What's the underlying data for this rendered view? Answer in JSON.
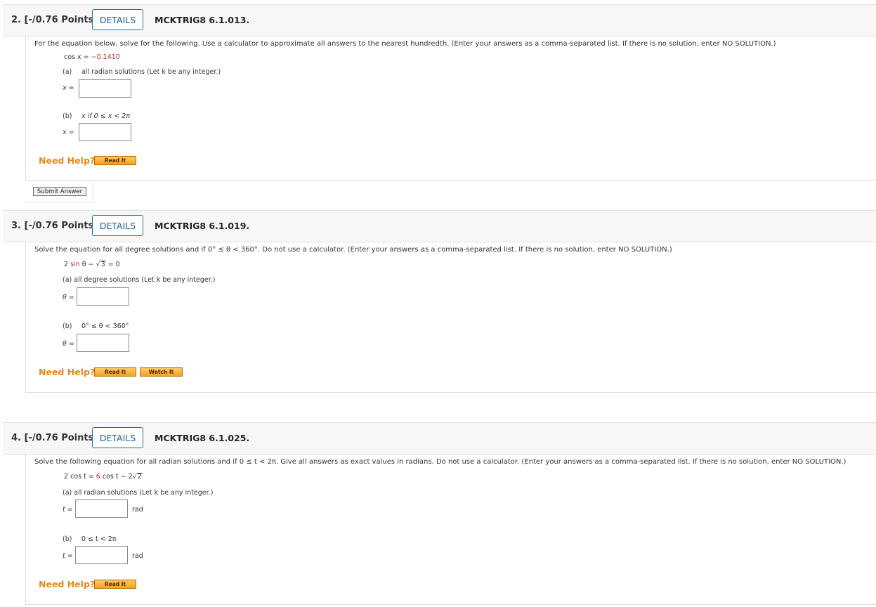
{
  "questions": [
    {
      "number": "2. [-/0.76 Points]",
      "details": "DETAILS",
      "code": "MCKTRIG8 6.1.013.",
      "prompt": "For the equation below, solve for the following. Use a calculator to approximate all answers to the nearest hundredth. (Enter your answers as a comma-separated list. If there is no solution, enter NO SOLUTION.)",
      "eq_left": "cos x = ",
      "eq_value": "−0.1410",
      "part_a_tag": "(a)",
      "part_a_text": "all radian solutions (Let k be any integer.)",
      "part_a_var": "x =",
      "part_b_tag": "(b)",
      "part_b_text": "x if 0 ≤ x < 2π",
      "part_b_var": "x =",
      "need_help": "Need Help?",
      "btn1": "Read It",
      "submit": "Submit Answer"
    },
    {
      "number": "3. [-/0.76 Points]",
      "details": "DETAILS",
      "code": "MCKTRIG8 6.1.019.",
      "prompt": "Solve the equation for all degree solutions and if 0° ≤ θ < 360°. Do not use a calculator. (Enter your answers as a comma-separated list. If there is no solution, enter NO SOLUTION.)",
      "eq_pre": "2 ",
      "eq_red": "sin",
      "eq_mid": " θ − ",
      "eq_root": "3",
      "eq_post": " = 0",
      "part_a_text": "(a) all degree solutions (Let k be any integer.)",
      "part_a_var": "θ =",
      "part_b_tag": "(b)",
      "part_b_text": "0° ≤ θ < 360°",
      "part_b_var": "θ =",
      "need_help": "Need Help?",
      "btn1": "Read It",
      "btn2": "Watch It"
    },
    {
      "number": "4. [-/0.76 Points]",
      "details": "DETAILS",
      "code": "MCKTRIG8 6.1.025.",
      "prompt": "Solve the following equation for all radian solutions and if 0 ≤ t < 2π. Give all answers as exact values in radians. Do not use a calculator. (Enter your answers as a comma-separated list. If there is no solution, enter NO SOLUTION.)",
      "eq_pre": "2 cos t = ",
      "eq_red": "6",
      "eq_mid": " cos t − 2",
      "eq_root": "2",
      "part_a_text": "(a) all radian solutions (Let k be any integer.)",
      "part_a_var": "t =",
      "unit": "rad",
      "part_b_tag": "(b)",
      "part_b_text": "0 ≤ t < 2π",
      "part_b_var": "t =",
      "need_help": "Need Help?",
      "btn1": "Read It"
    }
  ]
}
